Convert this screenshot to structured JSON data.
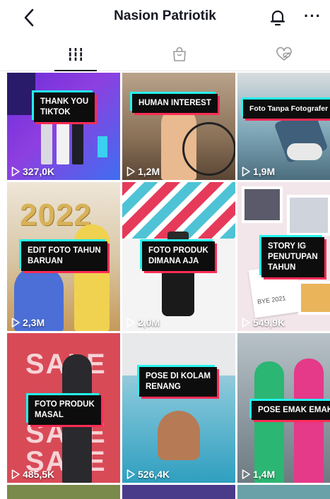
{
  "header": {
    "title": "Nasion Patriotik",
    "back_icon": "chevron-left-icon",
    "bell_icon": "bell-icon",
    "more_label": "···"
  },
  "tabs": [
    {
      "name": "videos",
      "icon": "grid-icon",
      "active": true
    },
    {
      "name": "shop",
      "icon": "shopping-bag-icon",
      "active": false
    },
    {
      "name": "liked",
      "icon": "heart-hidden-icon",
      "active": false
    }
  ],
  "videos": [
    {
      "label": "THANK YOU\nTIKTOK",
      "views": "327,0K"
    },
    {
      "label": "HUMAN INTEREST",
      "views": "1,2M"
    },
    {
      "label": "Foto Tanpa Fotografer",
      "views": "1,9M"
    },
    {
      "label": "EDIT FOTO TAHUN\nBARUAN",
      "views": "2,3M",
      "extra": "2022"
    },
    {
      "label": "FOTO PRODUK\nDIMANA AJA",
      "views": "2,0M"
    },
    {
      "label": "STORY IG\nPENUTUPAN\nTAHUN",
      "views": "549,9K",
      "extra": "BYE 2021"
    },
    {
      "label": "FOTO PRODUK\nMASAL",
      "views": "485,5K",
      "extra": "SALE"
    },
    {
      "label": "POSE DI KOLAM\nRENANG",
      "views": "526,4K"
    },
    {
      "label": "POSE EMAK EMAK",
      "views": "1,4M"
    }
  ],
  "colors": {
    "accent_cyan": "#25f4ee",
    "accent_red": "#fe2c55",
    "text": "#161823"
  }
}
